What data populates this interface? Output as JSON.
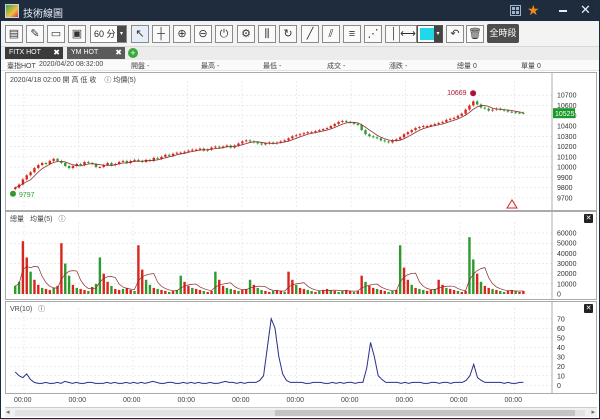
{
  "window": {
    "title": "技術線圖"
  },
  "toolbar": {
    "period_value": "60 分",
    "period_arrow": "▾",
    "all_time_label": "全時段",
    "icons": [
      "new-icon",
      "edit-icon",
      "open-icon",
      "save-icon",
      "cursor-icon",
      "crosshair-icon",
      "zoom-in-icon",
      "zoom-out-icon",
      "power-icon",
      "settings-icon",
      "indicator-icon",
      "refresh-icon",
      "line-tool-icon",
      "parallel-tool-icon",
      "fibonacci-icon",
      "fan-icon",
      "vertical-line-icon",
      "horizontal-ray-icon",
      "color-picker-icon",
      "undo-icon",
      "delete-icon"
    ],
    "selected_color": "#22d8e8"
  },
  "tabs": [
    {
      "label": "FITX HOT",
      "active": true
    },
    {
      "label": "YM HOT",
      "active": false
    }
  ],
  "quote": {
    "symbol": "臺指HOT",
    "datetime": "2020/04/20 08:32:00",
    "open_label": "開盤 -",
    "high_label": "最高 -",
    "low_label": "最低 -",
    "close_label": "成交 -",
    "change_label": "漲跌 -",
    "volume_label": "總量 0",
    "single_label": "單量 0"
  },
  "price_panel": {
    "header": "2020/4/18 02:00  開  高  低  收",
    "ma_label": "均價(5)",
    "high_marker": "10669",
    "low_marker": "9797",
    "last_price": "10525",
    "y_ticks": [
      "10700",
      "10600",
      "10500",
      "10400",
      "10300",
      "10200",
      "10100",
      "10000",
      "9900",
      "9800",
      "9700"
    ]
  },
  "volume_panel": {
    "label": "總量",
    "ma_label": "均量(5)",
    "y_ticks": [
      "60000",
      "50000",
      "40000",
      "30000",
      "20000",
      "10000",
      "0"
    ]
  },
  "vr_panel": {
    "label": "VR(10)",
    "y_ticks": [
      "70",
      "60",
      "50",
      "40",
      "30",
      "20",
      "10",
      "0"
    ]
  },
  "x_axis": {
    "labels": [
      "00:00",
      "00:00",
      "00:00",
      "00:00",
      "00:00",
      "00:00",
      "00:00",
      "00:00",
      "00:00",
      "00:00"
    ]
  },
  "colors": {
    "up": "#d8261c",
    "down": "#2d9a2d",
    "ma": "#8a2d2d",
    "vr": "#2a2e8c"
  },
  "chart_data": [
    {
      "type": "candlestick",
      "title": "",
      "ylim": [
        9650,
        10780
      ],
      "y_ticks": [
        9700,
        9800,
        9900,
        10000,
        10100,
        10200,
        10300,
        10400,
        10500,
        10600,
        10700
      ],
      "close": [
        9800,
        9830,
        9880,
        9920,
        9950,
        9990,
        10020,
        10040,
        10030,
        10060,
        10080,
        10060,
        10040,
        10010,
        9990,
        10010,
        10030,
        10020,
        10050,
        10040,
        10030,
        10000,
        10000,
        10020,
        10040,
        10020,
        10030,
        10050,
        10060,
        10040,
        10060,
        10070,
        10060,
        10050,
        10070,
        10060,
        10090,
        10080,
        10100,
        10120,
        10110,
        10130,
        10140,
        10140,
        10150,
        10160,
        10170,
        10170,
        10180,
        10160,
        10170,
        10190,
        10200,
        10190,
        10200,
        10210,
        10190,
        10210,
        10230,
        10250,
        10260,
        10250,
        10240,
        10230,
        10220,
        10230,
        10240,
        10230,
        10240,
        10250,
        10260,
        10280,
        10300,
        10310,
        10320,
        10330,
        10340,
        10340,
        10350,
        10360,
        10370,
        10380,
        10400,
        10420,
        10440,
        10450,
        10440,
        10430,
        10420,
        10410,
        10360,
        10320,
        10300,
        10290,
        10280,
        10260,
        10250,
        10240,
        10260,
        10270,
        10290,
        10320,
        10340,
        10360,
        10380,
        10390,
        10400,
        10400,
        10410,
        10420,
        10430,
        10440,
        10460,
        10470,
        10480,
        10500,
        10520,
        10560,
        10600,
        10640,
        10610,
        10580,
        10570,
        10550,
        10560,
        10570,
        10560,
        10550,
        10540,
        10535,
        10530,
        10528,
        10525
      ],
      "legend": [
        "均價(5)"
      ]
    },
    {
      "type": "bar",
      "title": "",
      "ylim": [
        0,
        65000
      ],
      "y_ticks": [
        0,
        10000,
        20000,
        30000,
        40000,
        50000,
        60000
      ],
      "values": [
        8000,
        12000,
        52000,
        36000,
        22000,
        14000,
        9000,
        6000,
        5000,
        4000,
        6000,
        8000,
        50000,
        30000,
        18000,
        9000,
        6000,
        5000,
        4000,
        3000,
        7000,
        10000,
        36000,
        20000,
        12000,
        8000,
        5000,
        4000,
        5000,
        6000,
        4000,
        3000,
        48000,
        24000,
        14000,
        9000,
        6000,
        5000,
        4000,
        3000,
        2000,
        3000,
        4000,
        18000,
        12000,
        8000,
        6000,
        5000,
        4000,
        3000,
        2000,
        3000,
        22000,
        14000,
        8000,
        6000,
        5000,
        4000,
        3000,
        4000,
        5000,
        14000,
        9000,
        6000,
        4000,
        3000,
        2000,
        3000,
        4000,
        3000,
        2000,
        22000,
        14000,
        9000,
        6000,
        5000,
        4000,
        3000,
        2000,
        3000,
        4000,
        5000,
        4000,
        3000,
        2000,
        3000,
        4000,
        3000,
        2000,
        3000,
        18000,
        12000,
        8000,
        6000,
        5000,
        4000,
        3000,
        2000,
        3000,
        4000,
        48000,
        26000,
        14000,
        9000,
        6000,
        5000,
        4000,
        3000,
        4000,
        5000,
        14000,
        9000,
        6000,
        5000,
        4000,
        3000,
        2000,
        3000,
        56000,
        34000,
        20000,
        12000,
        8000,
        6000,
        5000,
        4000,
        3000,
        2000,
        3000,
        4000,
        3000,
        2000,
        3000
      ]
    },
    {
      "type": "line",
      "title": "",
      "ylim": [
        -5,
        75
      ],
      "y_ticks": [
        0,
        10,
        20,
        30,
        40,
        50,
        60,
        70
      ],
      "values": [
        14,
        10,
        8,
        12,
        6,
        3,
        2,
        2,
        3,
        2,
        2,
        3,
        2,
        4,
        3,
        2,
        3,
        2,
        2,
        3,
        3,
        2,
        2,
        2,
        3,
        2,
        3,
        2,
        2,
        3,
        2,
        3,
        2,
        3,
        2,
        3,
        4,
        3,
        2,
        2,
        3,
        3,
        2,
        2,
        3,
        2,
        3,
        2,
        3,
        2,
        2,
        3,
        2,
        2,
        3,
        4,
        3,
        3,
        2,
        3,
        2,
        3,
        3,
        3,
        5,
        10,
        40,
        70,
        60,
        30,
        12,
        5,
        3,
        3,
        3,
        3,
        2,
        2,
        3,
        3,
        3,
        2,
        2,
        3,
        2,
        3,
        2,
        3,
        3,
        2,
        3,
        3,
        18,
        45,
        30,
        10,
        6,
        3,
        3,
        3,
        3,
        2,
        3,
        2,
        3,
        3,
        3,
        2,
        2,
        3,
        3,
        2,
        3,
        3,
        2,
        3,
        3,
        3,
        5,
        10,
        22,
        8,
        5,
        3,
        3,
        3,
        3,
        3,
        2,
        3,
        2,
        2,
        3,
        3
      ]
    }
  ]
}
